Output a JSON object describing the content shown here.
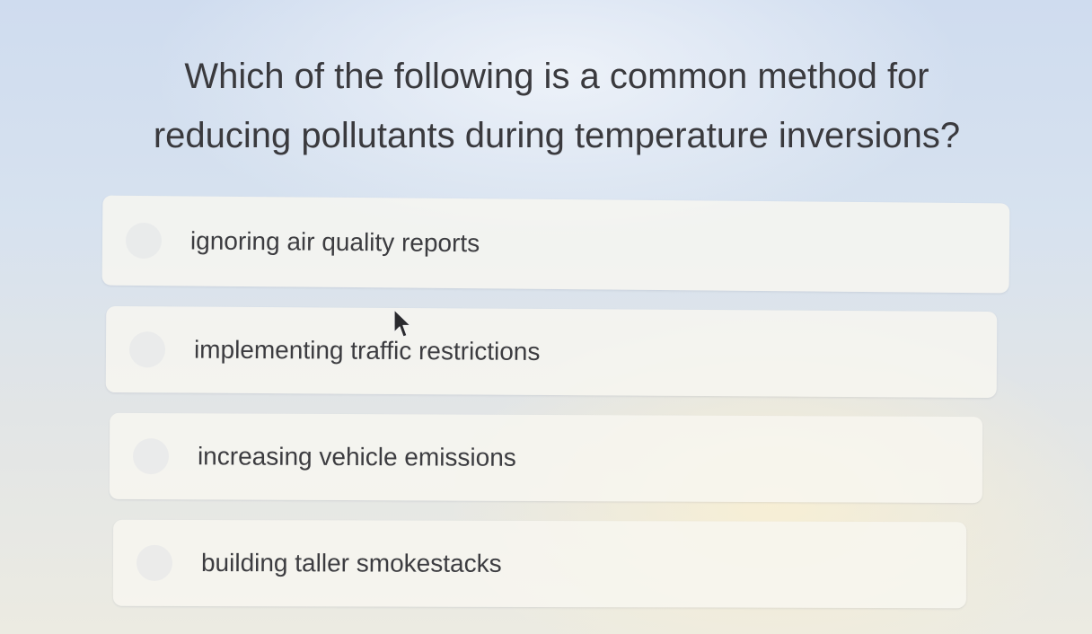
{
  "question": {
    "text": "Which of the following is a common method for reducing pollutants during temperature inversions?"
  },
  "options": [
    {
      "label": "ignoring air quality reports"
    },
    {
      "label": "implementing traffic restrictions"
    },
    {
      "label": "increasing vehicle emissions"
    },
    {
      "label": "building taller smokestacks"
    }
  ],
  "cursor": {
    "icon": "mouse-pointer-icon"
  }
}
